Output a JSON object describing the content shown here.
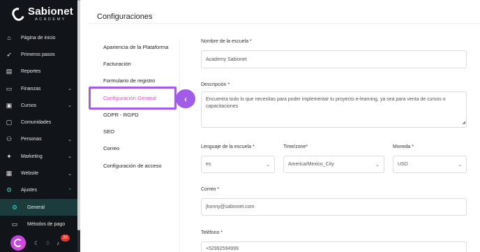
{
  "brand": {
    "name": "Sabionet",
    "sub": "ACADEMY"
  },
  "sidebar": {
    "items": [
      {
        "label": "Página de inicio",
        "icon": "home-icon",
        "glyph": "⌂",
        "chevron": false
      },
      {
        "label": "Primeros pasos",
        "icon": "rocket-icon",
        "glyph": "➶",
        "chevron": false
      },
      {
        "label": "Reportes",
        "icon": "reports-icon",
        "glyph": "▤",
        "chevron": false
      },
      {
        "label": "Finanzas",
        "icon": "wallet-icon",
        "glyph": "▭",
        "chevron": true
      },
      {
        "label": "Cursos",
        "icon": "courses-icon",
        "glyph": "▣",
        "chevron": true
      },
      {
        "label": "Comunidades",
        "icon": "chat-icon",
        "glyph": "▢",
        "chevron": false
      },
      {
        "label": "Personas",
        "icon": "people-icon",
        "glyph": "⚇",
        "chevron": true
      },
      {
        "label": "Marketing",
        "icon": "magic-wand-icon",
        "glyph": "✦",
        "chevron": true
      },
      {
        "label": "Website",
        "icon": "website-icon",
        "glyph": "▦",
        "chevron": true
      },
      {
        "label": "Ajustes",
        "icon": "gear-icon",
        "glyph": "⚙",
        "chevron": true
      }
    ],
    "sub_items": [
      {
        "label": "General",
        "icon": "gear-icon",
        "glyph": "⚙"
      },
      {
        "label": "Métodos de pago",
        "icon": "credit-card-icon",
        "glyph": "▭"
      }
    ],
    "notifications_count": "20"
  },
  "page": {
    "title": "Configuraciones"
  },
  "settings_nav": {
    "items": [
      "Apariencia de la Plataforma",
      "Facturación",
      "Formulario de registro",
      "Configuración General",
      "GDPR - RGPD",
      "SEO",
      "Correo",
      "Configuración de acceso"
    ]
  },
  "form": {
    "school_name_label": "Nombre de la escuela *",
    "school_name_value": "Academy Sabionet",
    "description_label": "Descripción *",
    "description_value": "Encuentra todo lo que necesitas para poder implementar tu proyecto e-learning, ya sea para venta de cursos o capacitaciones",
    "language_label": "Lenguaje de la escuela *",
    "language_value": "es",
    "timezone_label": "Time/zone*",
    "timezone_value": "America/Mexico_City",
    "currency_label": "Moneda *",
    "currency_value": "USD",
    "email_label": "Correo *",
    "email_value": "jhonny@sabionet.com",
    "phone_label": "Teléfono *",
    "phone_value": "+52992594999"
  },
  "colors": {
    "accent": "#a35ce8",
    "highlight_text": "#e04fc6",
    "teal": "#2bd7c0",
    "sidebar_bg": "#111418"
  }
}
